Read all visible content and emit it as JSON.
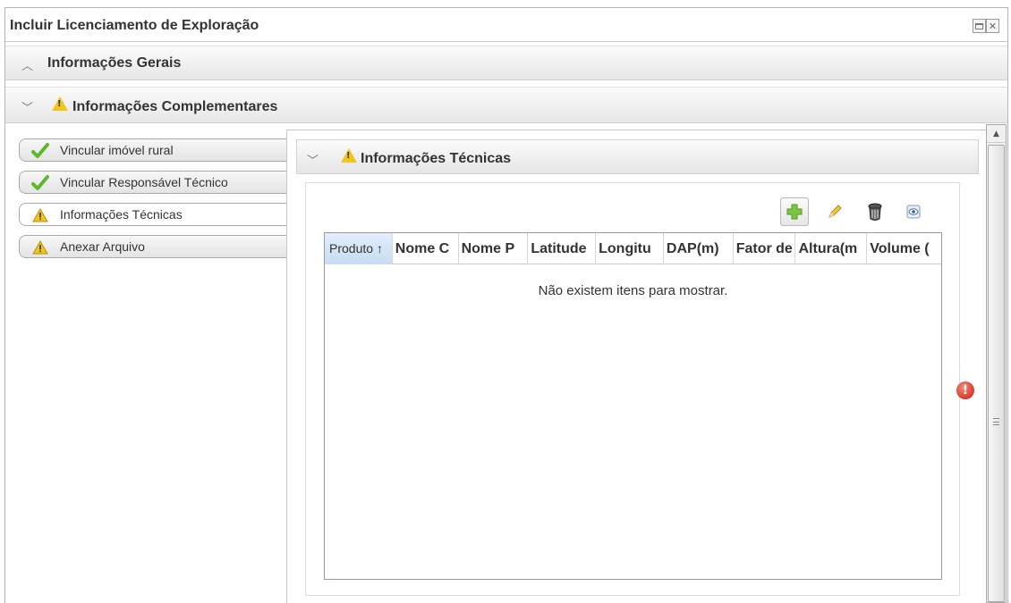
{
  "window": {
    "title": "Incluir Licenciamento de Exploração"
  },
  "sections": {
    "general": {
      "label": "Informações Gerais",
      "state": "collapsed"
    },
    "complementary": {
      "label": "Informações Complementares",
      "state": "expanded",
      "status_icon": "warning-icon"
    }
  },
  "nav": {
    "items": [
      {
        "label": "Vincular imóvel rural",
        "status_icon": "check-icon"
      },
      {
        "label": "Vincular Responsável Técnico",
        "status_icon": "check-icon"
      },
      {
        "label": "Informações Técnicas",
        "status_icon": "warning-icon",
        "selected": true
      },
      {
        "label": "Anexar Arquivo",
        "status_icon": "warning-icon"
      }
    ]
  },
  "panel": {
    "title": "Informações Técnicas",
    "status_icon": "warning-icon",
    "toolbar": [
      "add-icon",
      "edit-icon",
      "delete-icon",
      "view-icon"
    ],
    "grid": {
      "columns": [
        "Produto ↑",
        "Nome C",
        "Nome P",
        "Latitude",
        "Longitu",
        "DAP(m)",
        "Fator de",
        "Altura(m",
        "Volume ("
      ],
      "empty_text": "Não existem itens para mostrar."
    }
  },
  "colors": {
    "warning": "#f0c51e",
    "success": "#5cb82e",
    "error": "#d9402e",
    "header_selected": "#c8dcf2"
  }
}
